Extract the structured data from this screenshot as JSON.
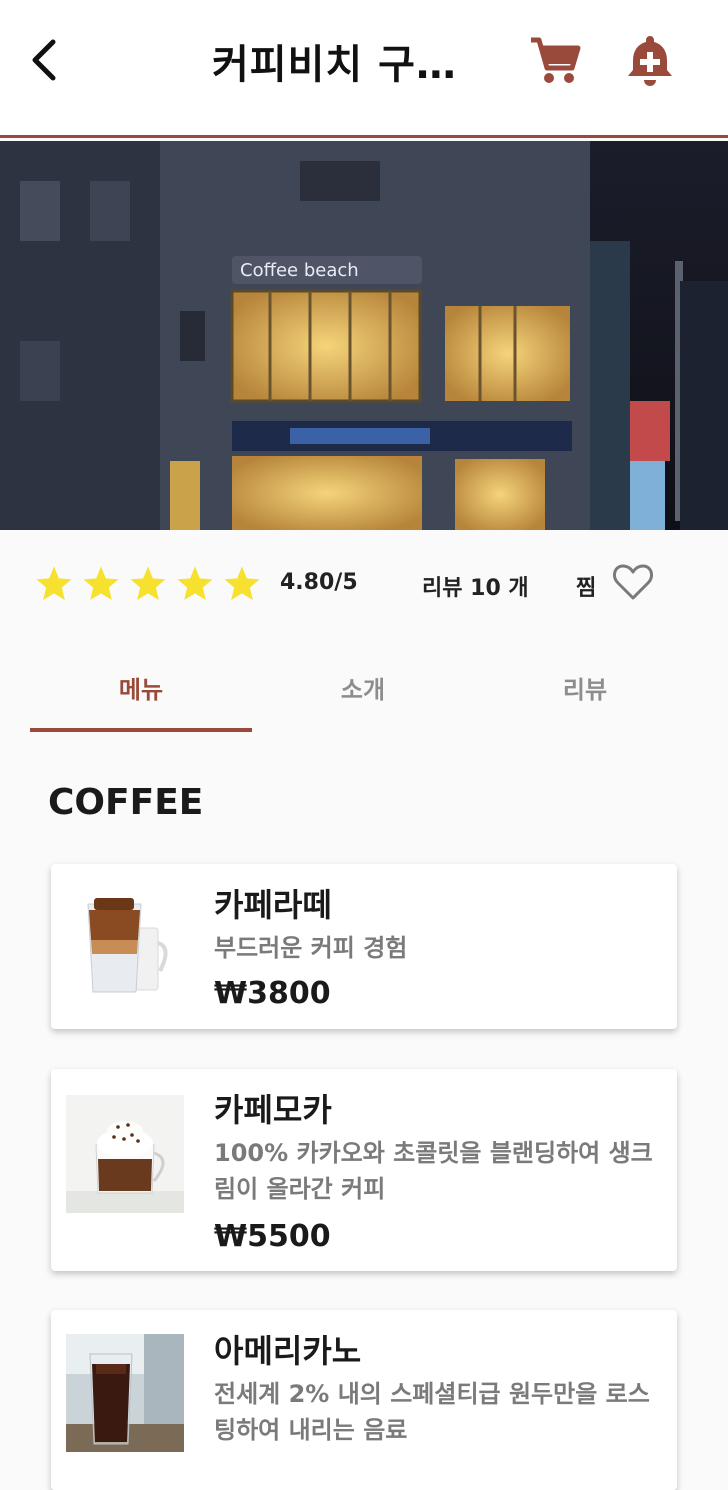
{
  "header": {
    "title": "커피비치 구…",
    "back_icon": "chevron-left-icon",
    "cart_icon": "cart-icon",
    "bell_icon": "bell-plus-icon",
    "accent_color": "#9a4a3a"
  },
  "store": {
    "hero_image": "store-night-photo",
    "rating": {
      "stars": 5,
      "text": "4.80/5"
    },
    "review_count": "리뷰 10 개",
    "zzim_label": "찜"
  },
  "tabs": [
    {
      "label": "메뉴",
      "active": true
    },
    {
      "label": "소개",
      "active": false
    },
    {
      "label": "리뷰",
      "active": false
    }
  ],
  "menu": {
    "section_title": "COFFEE",
    "items": [
      {
        "name": "카페라떼",
        "description": "부드러운 커피 경험",
        "price": "₩3800",
        "image": "cafe-latte-photo"
      },
      {
        "name": "카페모카",
        "description": "100% 카카오와 초콜릿을 블랜딩하여 생크림이 올라간 커피",
        "price": "₩5500",
        "image": "cafe-mocha-photo"
      },
      {
        "name": "아메리카노",
        "description": "전세계 2% 내의 스페셜티급 원두만을 로스팅하여 내리는 음료",
        "price": "",
        "image": "americano-photo"
      }
    ]
  }
}
